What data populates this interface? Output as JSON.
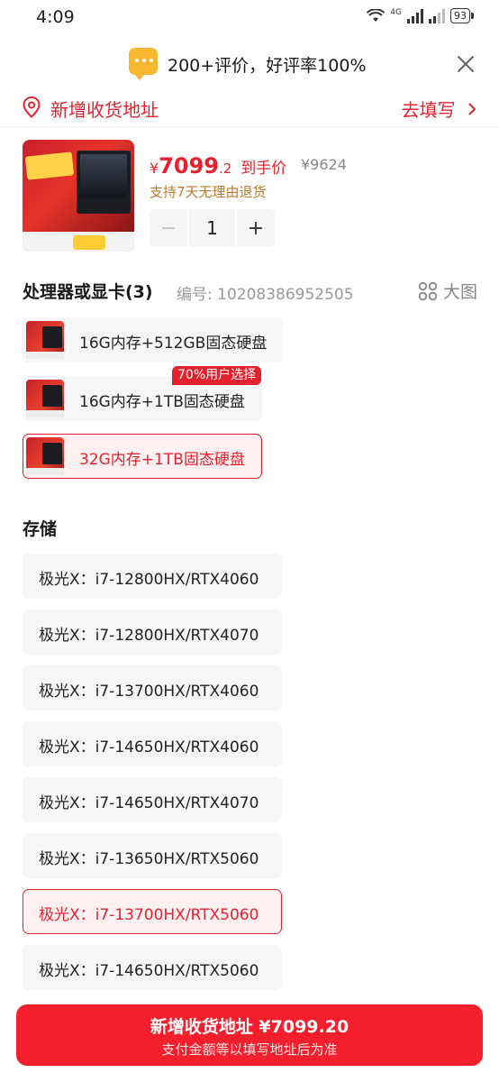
{
  "status_bar": {
    "time": "4:09",
    "network": "4G",
    "battery": "93"
  },
  "header": {
    "title": "200+评价，好评率100%"
  },
  "address": {
    "label": "新增收货地址",
    "action": "去填写"
  },
  "product": {
    "price_yen": "¥",
    "price_main": "7099",
    "price_decimal": ".2",
    "price_label": "到手价",
    "original_price": "¥9624",
    "return_policy": "支持7天无理由退货",
    "quantity": "1"
  },
  "variant_section": {
    "title": "处理器或显卡(3)",
    "code": "编号: 10208386952505",
    "big_view": "大图",
    "options": [
      {
        "label": "16G内存+512GB固态硬盘"
      },
      {
        "label": "16G内存+1TB固态硬盘",
        "badge": "70%用户选择"
      },
      {
        "label": "32G内存+1TB固态硬盘",
        "selected": true
      }
    ]
  },
  "storage_section": {
    "title": "存储",
    "options": [
      {
        "label": "极光X：i7-12800HX/RTX4060"
      },
      {
        "label": "极光X：i7-12800HX/RTX4070"
      },
      {
        "label": "极光X：i7-13700HX/RTX4060"
      },
      {
        "label": "极光X：i7-14650HX/RTX4060"
      },
      {
        "label": "极光X：i7-14650HX/RTX4070"
      },
      {
        "label": "极光X：i7-13650HX/RTX5060"
      },
      {
        "label": "极光X：i7-13700HX/RTX5060",
        "selected": true
      },
      {
        "label": "极光X：i7-14650HX/RTX5060"
      }
    ]
  },
  "bottom_bar": {
    "main": "新增收货地址 ¥7099.20",
    "sub": "支付金额等以填写地址后为准"
  },
  "colors": {
    "accent": "#e4222f",
    "button": "#f41f2d",
    "option_bg": "#f5f6f8"
  }
}
